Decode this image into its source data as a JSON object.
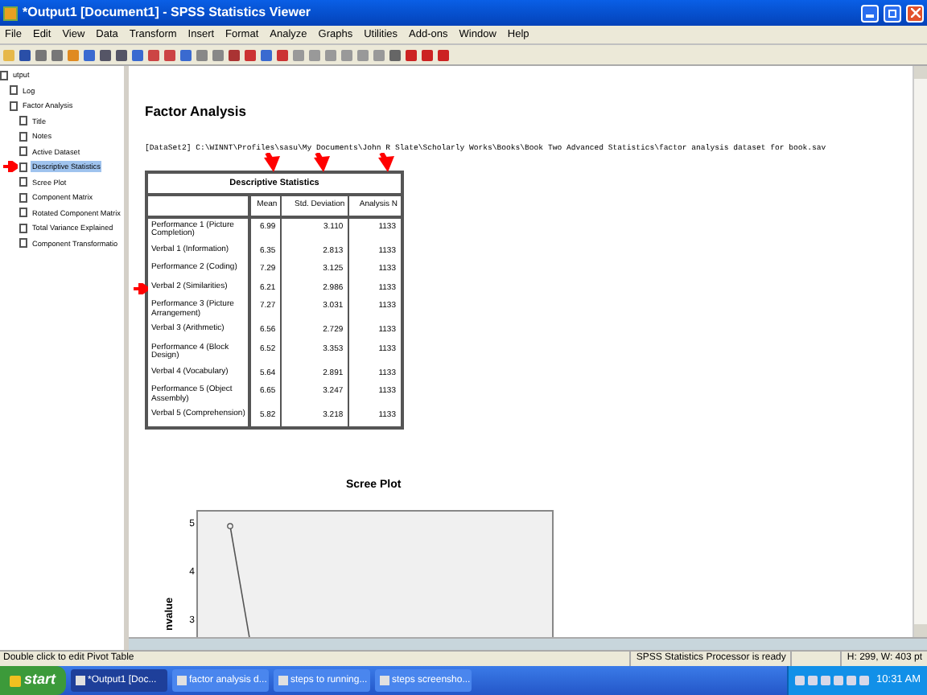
{
  "window": {
    "title": "*Output1 [Document1] - SPSS Statistics Viewer"
  },
  "menu": [
    "File",
    "Edit",
    "View",
    "Data",
    "Transform",
    "Insert",
    "Format",
    "Analyze",
    "Graphs",
    "Utilities",
    "Add-ons",
    "Window",
    "Help"
  ],
  "outline": [
    {
      "label": "utput",
      "selected": false,
      "children": [
        {
          "label": "Log",
          "selected": false
        },
        {
          "label": "Factor Analysis",
          "selected": false,
          "children": [
            {
              "label": "Title",
              "selected": false
            },
            {
              "label": "Notes",
              "selected": false
            },
            {
              "label": "Active Dataset",
              "selected": false
            },
            {
              "label": "Descriptive Statistics",
              "selected": true
            },
            {
              "label": "Scree Plot",
              "selected": false
            },
            {
              "label": "Component Matrix",
              "selected": false
            },
            {
              "label": "Rotated Component Matrix",
              "selected": false
            },
            {
              "label": "Total Variance Explained",
              "selected": false
            },
            {
              "label": "Component Transformatio",
              "selected": false
            }
          ]
        }
      ]
    }
  ],
  "content": {
    "heading": "Factor Analysis",
    "dataset_path": "[DataSet2] C:\\WINNT\\Profiles\\sasu\\My Documents\\John R Slate\\Scholarly Works\\Books\\Book Two Advanced Statistics\\factor analysis dataset for book.sav",
    "table": {
      "title": "Descriptive Statistics",
      "columns": [
        "Mean",
        "Std. Deviation",
        "Analysis N"
      ],
      "rows": [
        {
          "label": "Performance 1 (Picture Completion)",
          "cells": [
            "6.99",
            "3.110",
            "1133"
          ]
        },
        {
          "label": "Verbal 1 (Information)",
          "cells": [
            "6.35",
            "2.813",
            "1133"
          ]
        },
        {
          "label": "Performance 2 (Coding)",
          "cells": [
            "7.29",
            "3.125",
            "1133"
          ]
        },
        {
          "label": "Verbal 2 (Similarities)",
          "cells": [
            "6.21",
            "2.986",
            "1133"
          ]
        },
        {
          "label": "Performance 3 (Picture Arrangement)",
          "cells": [
            "7.27",
            "3.031",
            "1133"
          ]
        },
        {
          "label": "Verbal 3 (Arithmetic)",
          "cells": [
            "6.56",
            "2.729",
            "1133"
          ]
        },
        {
          "label": "Performance 4 (Block Design)",
          "cells": [
            "6.52",
            "3.353",
            "1133"
          ]
        },
        {
          "label": "Verbal 4 (Vocabulary)",
          "cells": [
            "5.64",
            "2.891",
            "1133"
          ]
        },
        {
          "label": "Performance 5 (Object Assembly)",
          "cells": [
            "6.65",
            "3.247",
            "1133"
          ]
        },
        {
          "label": "Verbal 5 (Comprehension)",
          "cells": [
            "5.82",
            "3.218",
            "1133"
          ]
        }
      ]
    },
    "scree_plot": {
      "title": "Scree Plot",
      "axis_label": "nvalue",
      "tick_labels": [
        "5",
        "4",
        "3"
      ]
    }
  },
  "status_bar": {
    "message": "Double click to edit Pivot Table",
    "processor": "SPSS Statistics  Processor is ready",
    "size": "H: 299, W: 403 pt"
  },
  "taskbar": {
    "start": "start",
    "items": [
      {
        "label": "*Output1 [Doc...",
        "selected": true
      },
      {
        "label": "factor analysis d...",
        "selected": false
      },
      {
        "label": "steps to running...",
        "selected": false
      },
      {
        "label": "steps screensho...",
        "selected": false
      }
    ],
    "clock": "10:31 AM"
  }
}
